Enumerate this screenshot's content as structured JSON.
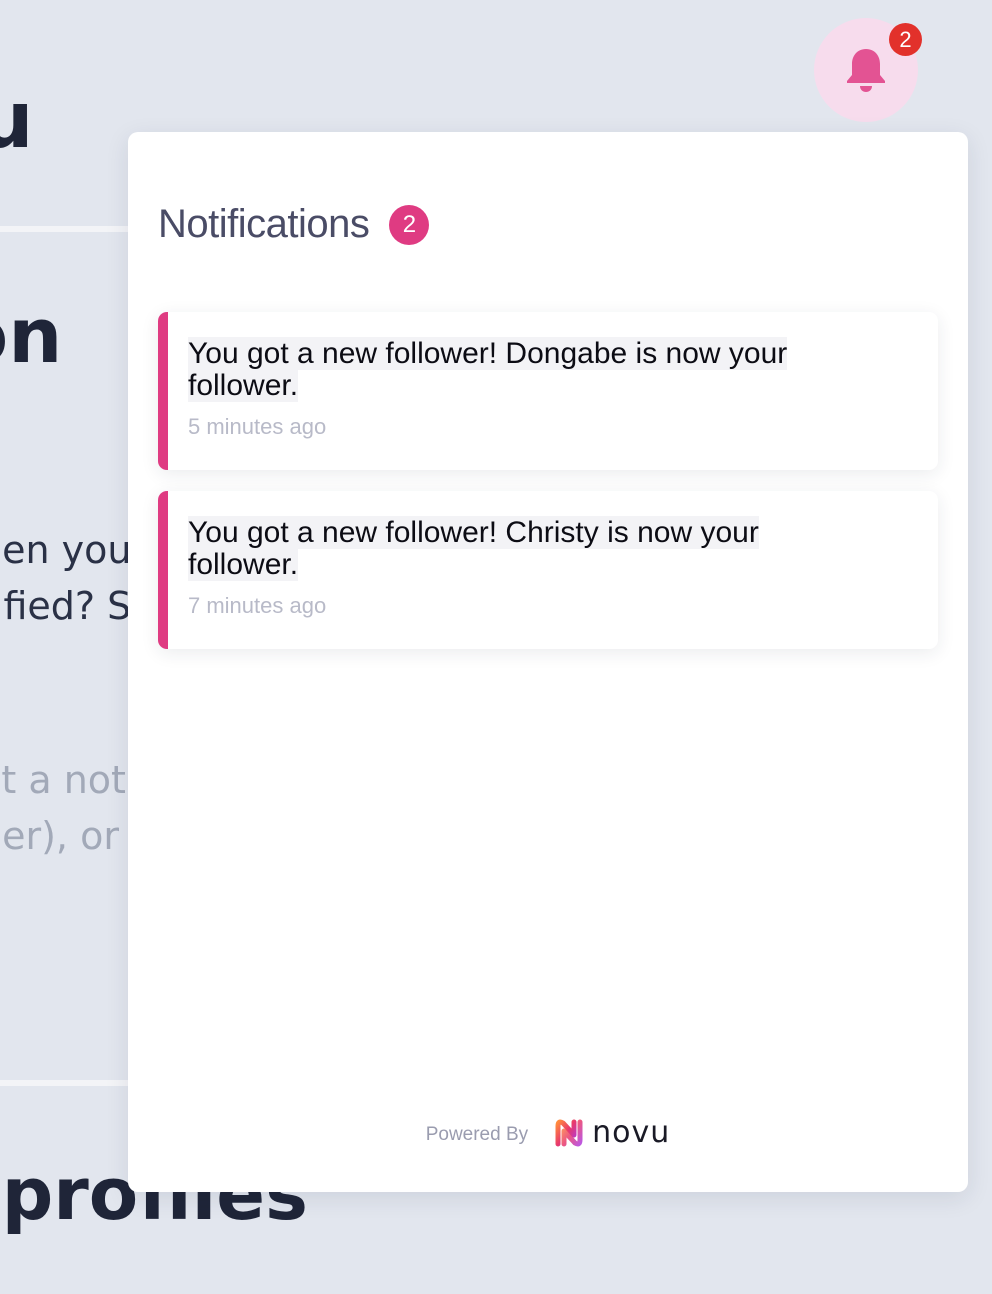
{
  "background": {
    "heading_1": "u",
    "heading_2": "on",
    "paragraph_1_line_1": "hen you",
    "paragraph_1_line_2": "tified? S",
    "paragraph_2_line_1": "et a not",
    "paragraph_2_line_2": "her), or i",
    "heading_3": "l profiles"
  },
  "bell": {
    "icon": "bell-icon",
    "unseen_count": "2",
    "accent_color": "#df3b82",
    "badge_color": "#e2312b"
  },
  "panel": {
    "title": "Notifications",
    "count": "2",
    "notifications": [
      {
        "message": "You got a new follower! Dongabe is now your follower.",
        "time": "5 minutes ago"
      },
      {
        "message": "You got a new follower! Christy is now your follower.",
        "time": "7 minutes ago"
      }
    ],
    "footer": {
      "powered_by": "Powered By",
      "brand": "novu"
    }
  }
}
